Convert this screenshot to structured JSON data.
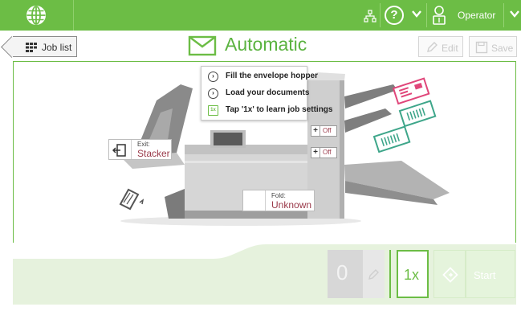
{
  "topbar": {
    "user_label": "Operator",
    "icons": [
      "globe-icon",
      "network-icon",
      "help-icon",
      "chevron-down-icon",
      "operator-icon",
      "chevron-down-icon"
    ],
    "accent_color": "#6cbd45"
  },
  "header": {
    "back_label": "Job list",
    "title": "Automatic",
    "edit_label": "Edit",
    "save_label": "Save"
  },
  "hints": {
    "items": [
      {
        "icon": "chevron-right-circle-icon",
        "text": "Fill the envelope hopper"
      },
      {
        "icon": "chevron-right-circle-icon",
        "text": "Load your documents"
      },
      {
        "icon": "1x-icon",
        "text": "Tap '1x' to learn job settings"
      }
    ],
    "onex_glyph": "1x"
  },
  "machine": {
    "exit_key": "Exit:",
    "exit_value": "Stacker",
    "fold_key": "Fold:",
    "fold_value": "Unknown",
    "feeder_1": {
      "plus": "+",
      "state": "Off"
    },
    "feeder_2": {
      "plus": "+",
      "state": "Off"
    }
  },
  "bottom": {
    "counter": "0",
    "onex_label": "1x",
    "start_label": "Start"
  }
}
